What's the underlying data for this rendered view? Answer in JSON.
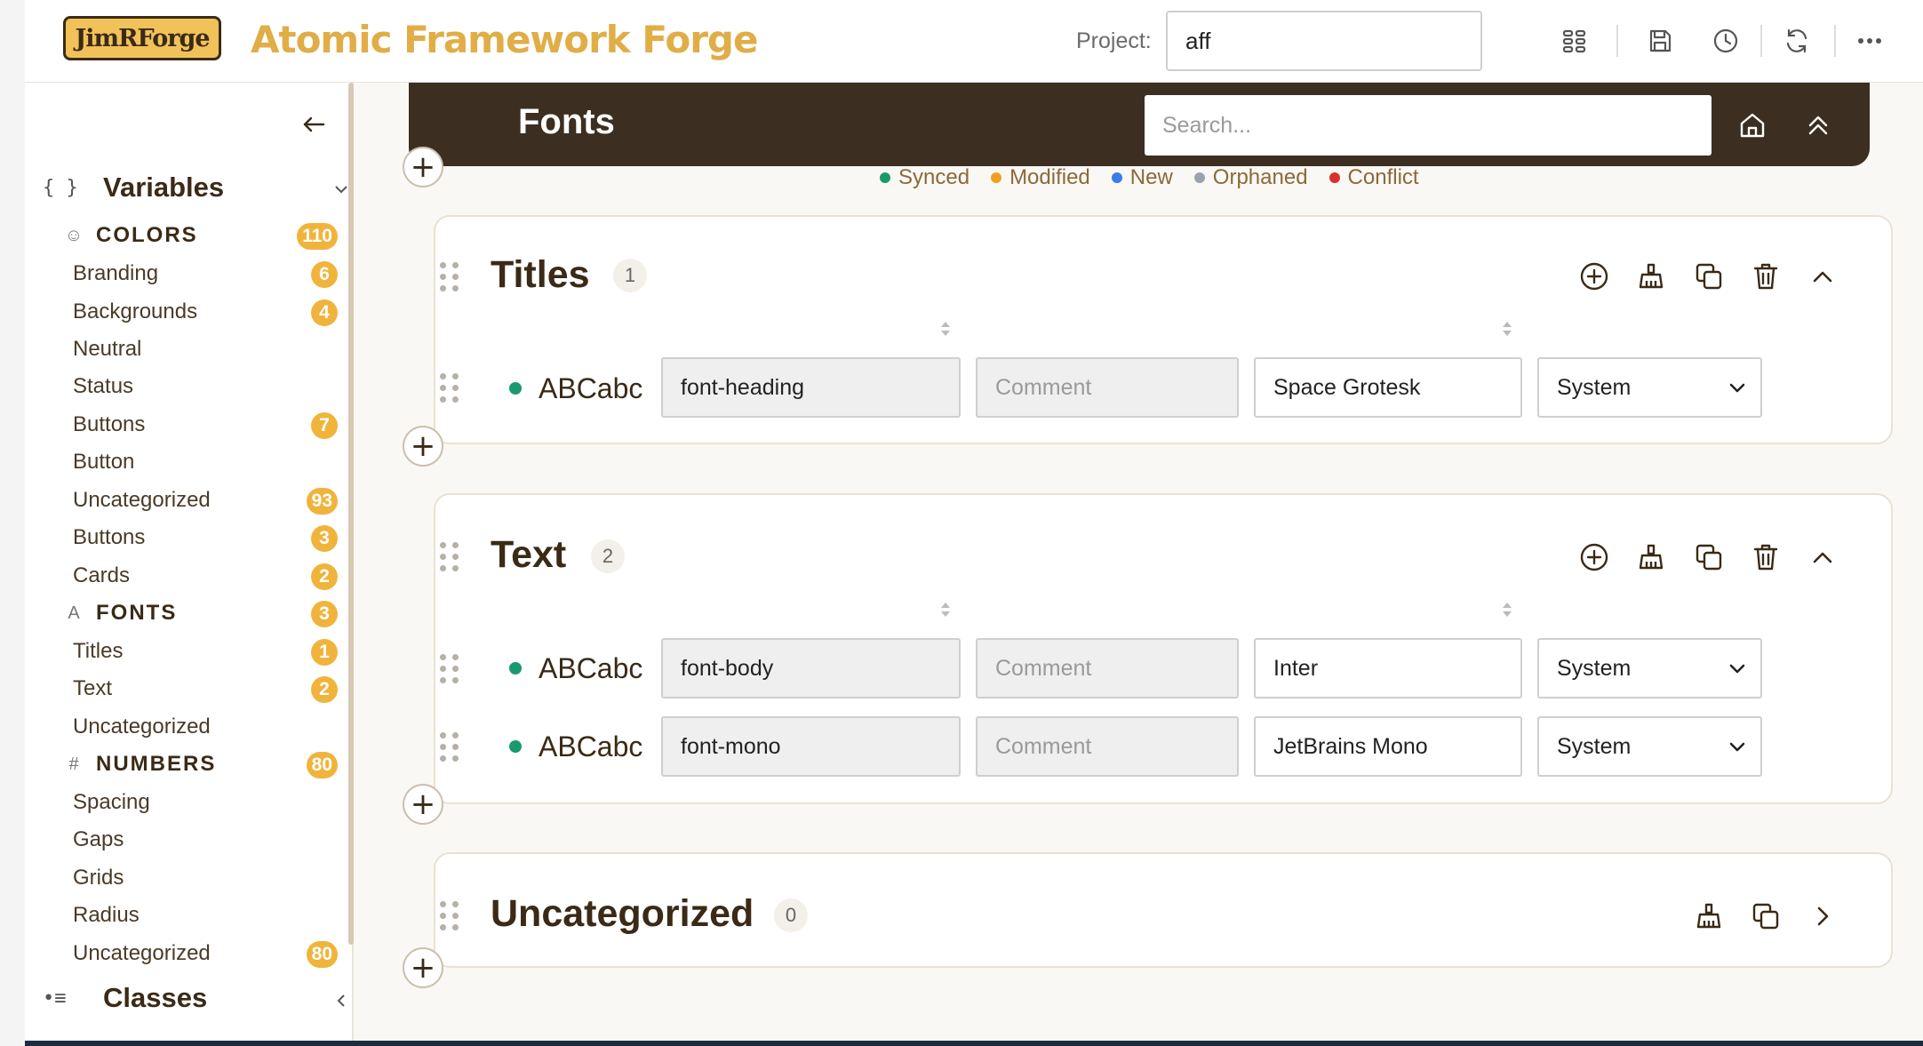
{
  "header": {
    "logo_text": "JimRForge",
    "app_title": "Atomic Framework Forge",
    "project_label": "Project:",
    "project_value": "aff",
    "icons": [
      "grid-icon",
      "save-icon",
      "history-icon",
      "sync-icon",
      "more-icon"
    ]
  },
  "sidebar": {
    "variables_title": "Variables",
    "classes_title": "Classes",
    "categories": [
      {
        "icon": "palette-icon",
        "glyph": "☺",
        "label": "COLORS",
        "count": "110",
        "items": [
          {
            "label": "Branding",
            "count": "6"
          },
          {
            "label": "Backgrounds",
            "count": "4"
          },
          {
            "label": "Neutral",
            "count": ""
          },
          {
            "label": "Status",
            "count": ""
          },
          {
            "label": "Buttons",
            "count": "7"
          },
          {
            "label": "Button",
            "count": ""
          },
          {
            "label": "Uncategorized",
            "count": "93"
          },
          {
            "label": "Buttons",
            "count": "3"
          },
          {
            "label": "Cards",
            "count": "2"
          }
        ]
      },
      {
        "icon": "font-icon",
        "glyph": "A",
        "label": "FONTS",
        "count": "3",
        "items": [
          {
            "label": "Titles",
            "count": "1"
          },
          {
            "label": "Text",
            "count": "2"
          },
          {
            "label": "Uncategorized",
            "count": ""
          }
        ]
      },
      {
        "icon": "hash-icon",
        "glyph": "#",
        "label": "NUMBERS",
        "count": "80",
        "items": [
          {
            "label": "Spacing",
            "count": ""
          },
          {
            "label": "Gaps",
            "count": ""
          },
          {
            "label": "Grids",
            "count": ""
          },
          {
            "label": "Radius",
            "count": ""
          },
          {
            "label": "Uncategorized",
            "count": "80"
          }
        ]
      }
    ]
  },
  "main": {
    "title": "Fonts",
    "search_placeholder": "Search...",
    "legend": [
      {
        "label": "Synced",
        "color": "#1a9a6c"
      },
      {
        "label": "Modified",
        "color": "#f0a020"
      },
      {
        "label": "New",
        "color": "#3d7be8"
      },
      {
        "label": "Orphaned",
        "color": "#9aa3ad"
      },
      {
        "label": "Conflict",
        "color": "#d93030"
      }
    ],
    "groups": [
      {
        "title": "Titles",
        "count": "1",
        "rows": [
          {
            "preview": "ABCabc",
            "name": "font-heading",
            "comment_placeholder": "Comment",
            "value": "Space Grotesk",
            "type": "System"
          }
        ]
      },
      {
        "title": "Text",
        "count": "2",
        "rows": [
          {
            "preview": "ABCabc",
            "name": "font-body",
            "comment_placeholder": "Comment",
            "value": "Inter",
            "type": "System"
          },
          {
            "preview": "ABCabc",
            "name": "font-mono",
            "comment_placeholder": "Comment",
            "value": "JetBrains Mono",
            "type": "System"
          }
        ]
      },
      {
        "title": "Uncategorized",
        "count": "0",
        "rows": []
      }
    ]
  }
}
